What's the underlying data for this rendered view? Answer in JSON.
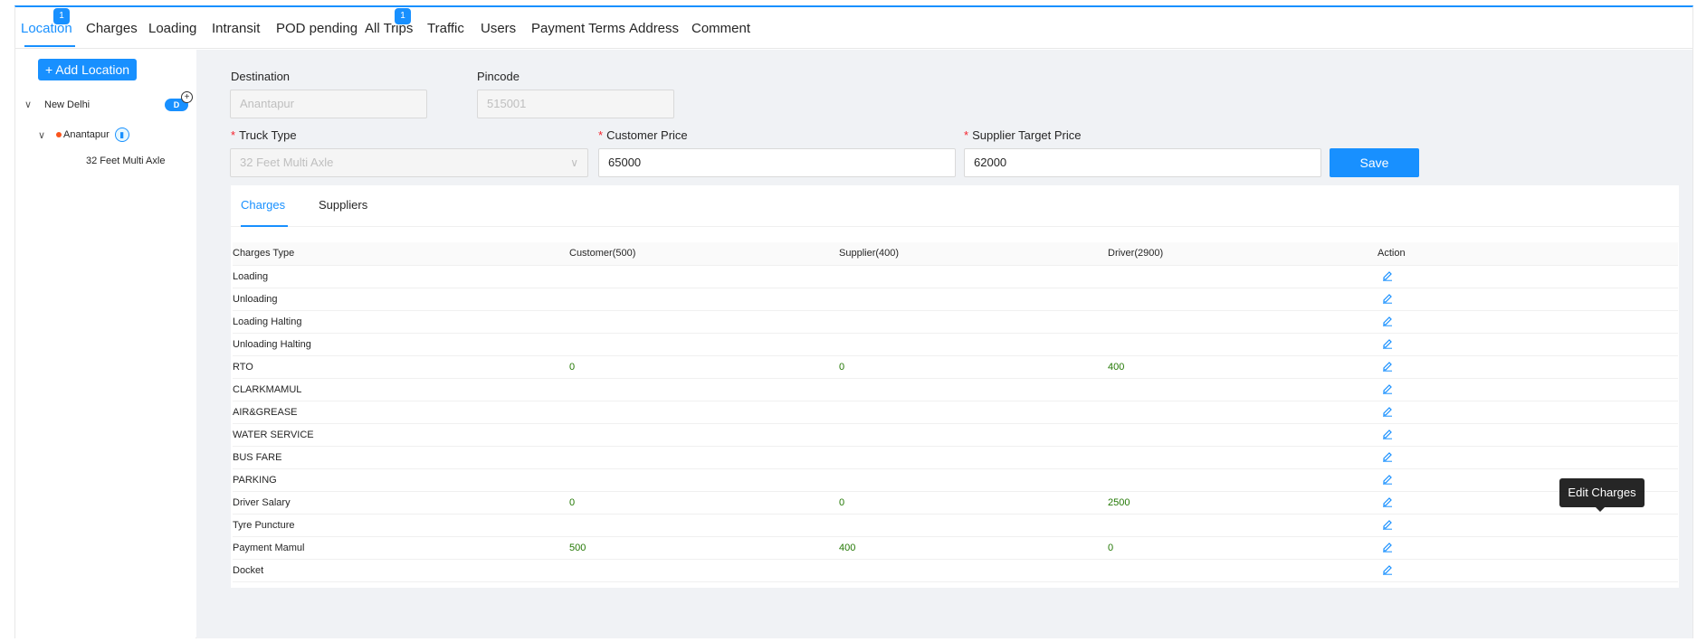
{
  "top_tabs": [
    {
      "label": "Location",
      "badge": "1"
    },
    {
      "label": "Charges"
    },
    {
      "label": "Loading"
    },
    {
      "label": "Intransit"
    },
    {
      "label": "POD pending"
    },
    {
      "label": "All Trips",
      "badge": "1"
    },
    {
      "label": "Traffic"
    },
    {
      "label": "Users"
    },
    {
      "label": "Payment Terms"
    },
    {
      "label": "Address"
    },
    {
      "label": "Comment"
    }
  ],
  "sidebar": {
    "add_button": "+ Add Location",
    "tree": {
      "origin": "New Delhi",
      "origin_badge": "D",
      "destination": "Anantapur",
      "truck": "32 Feet Multi Axle"
    }
  },
  "form": {
    "destination_label": "Destination",
    "destination_value": "Anantapur",
    "pincode_label": "Pincode",
    "pincode_value": "515001",
    "truck_type_label": "Truck Type",
    "truck_type_value": "32 Feet Multi Axle",
    "customer_price_label": "Customer Price",
    "customer_price_value": "65000",
    "supplier_price_label": "Supplier Target Price",
    "supplier_price_value": "62000",
    "required_mark": "*",
    "save_label": "Save"
  },
  "card": {
    "tabs": [
      "Charges",
      "Suppliers"
    ],
    "table": {
      "headers": [
        "Charges Type",
        "Customer(500)",
        "Supplier(400)",
        "Driver(2900)",
        "Action"
      ],
      "rows": [
        [
          "Loading",
          "",
          "",
          ""
        ],
        [
          "Unloading",
          "",
          "",
          ""
        ],
        [
          "Loading Halting",
          "",
          "",
          ""
        ],
        [
          "Unloading Halting",
          "",
          "",
          ""
        ],
        [
          "RTO",
          "0",
          "0",
          "400"
        ],
        [
          "CLARKMAMUL",
          "",
          "",
          ""
        ],
        [
          "AIR&GREASE",
          "",
          "",
          ""
        ],
        [
          "WATER SERVICE",
          "",
          "",
          ""
        ],
        [
          "BUS FARE",
          "",
          "",
          ""
        ],
        [
          "PARKING",
          "",
          "",
          ""
        ],
        [
          "Driver Salary",
          "0",
          "0",
          "2500"
        ],
        [
          "Tyre Puncture",
          "",
          "",
          ""
        ],
        [
          "Payment Mamul",
          "500",
          "400",
          "0"
        ],
        [
          "Docket",
          "",
          "",
          ""
        ]
      ]
    },
    "tooltip": "Edit Charges"
  }
}
